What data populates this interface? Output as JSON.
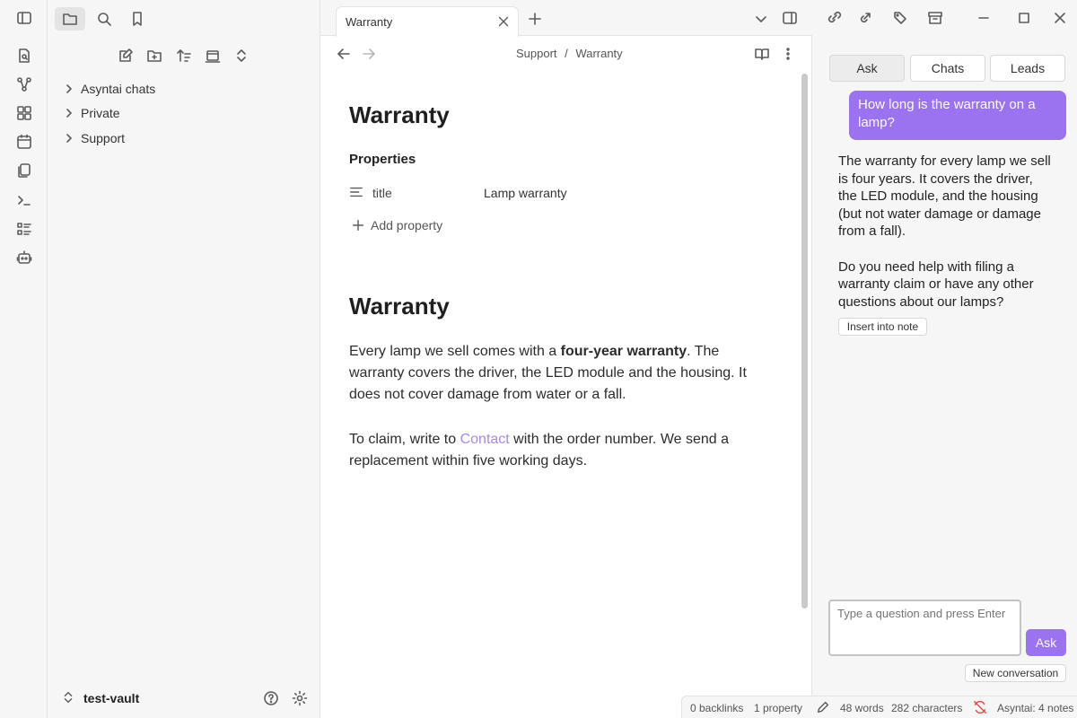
{
  "sidebar": {
    "items": [
      {
        "label": "Asyntai chats"
      },
      {
        "label": "Private"
      },
      {
        "label": "Support"
      }
    ],
    "vault_name": "test-vault"
  },
  "tab": {
    "title": "Warranty"
  },
  "breadcrumb": {
    "parent": "Support",
    "separator": "/",
    "current": "Warranty"
  },
  "note": {
    "title": "Warranty",
    "properties_label": "Properties",
    "property_key": "title",
    "property_value": "Lamp warranty",
    "add_property_label": "Add property",
    "heading": "Warranty",
    "p1_before": "Every lamp we sell comes with a ",
    "p1_bold": "four-year warranty",
    "p1_after": ". The warranty covers the driver, the LED module and the housing. It does not cover damage from water or a fall.",
    "p2_before": "To claim, write to ",
    "p2_link": "Contact",
    "p2_after": " with the order number. We send a replacement within five working days."
  },
  "chat": {
    "tabs": [
      "Ask",
      "Chats",
      "Leads"
    ],
    "user_message": "How long is the warranty on a lamp?",
    "answer_p1": "The warranty for every lamp we sell is four years. It covers the driver, the LED module, and the housing (but not water damage or damage from a fall).",
    "answer_p2": "Do you need help with filing a warranty claim or have any other questions about our lamps?",
    "insert_label": "Insert into note",
    "input_placeholder": "Type a question and press Enter",
    "ask_button": "Ask",
    "new_conversation": "New conversation"
  },
  "status": {
    "backlinks": "0 backlinks",
    "properties": "1 property",
    "words": "48 words",
    "characters": "282 characters",
    "asyntai": "Asyntai: 4 notes"
  },
  "colors": {
    "accent": "#9b72f0",
    "link": "#a98ae0"
  }
}
